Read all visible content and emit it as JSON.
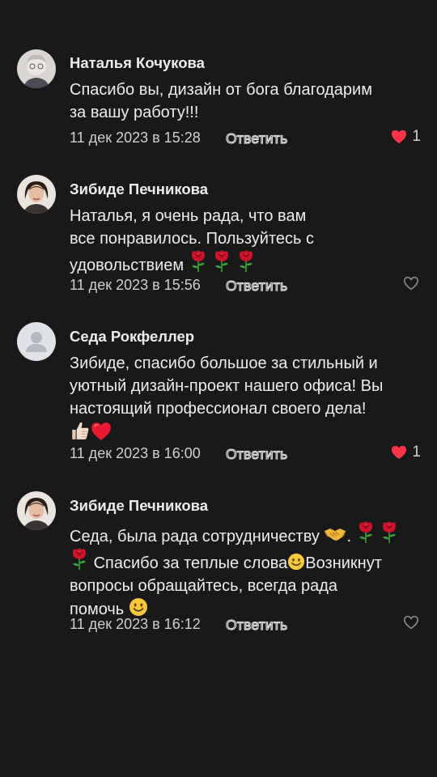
{
  "comments": [
    {
      "author": "Наталья Кочукова",
      "text_lines": [
        "Спасибо вы, дизайн от бога благодарим",
        "за вашу работу!!!"
      ],
      "date": "11 дек 2023 в 15:28",
      "reply_label": "Ответить",
      "liked": true,
      "like_count": "1"
    },
    {
      "author": "Зибиде Печникова",
      "text_lines": [
        "Наталья, я очень рада, что вам",
        "все понравилось. Пользуйтесь с",
        "удовольствием"
      ],
      "date": "11 дек 2023 в 15:56",
      "reply_label": "Ответить",
      "liked": false,
      "like_count": ""
    },
    {
      "author": "Седа Рокфеллер",
      "text_lines": [
        "Зибиде, спасибо большое за стильный и",
        "уютный дизайн-проект нашего офиса! Вы",
        "настоящий профессионал своего дела!"
      ],
      "date": "11 дек 2023 в 16:00",
      "reply_label": "Ответить",
      "liked": true,
      "like_count": "1"
    },
    {
      "author": "Зибиде Печникова",
      "text_lines": [
        "Седа, была рада сотрудничеству",
        "Спасибо за теплые слова",
        "Возникнут",
        "вопросы обращайтесь, всегда рада",
        "помочь"
      ],
      "date": "11 дек 2023 в 16:12",
      "reply_label": "Ответить",
      "liked": false,
      "like_count": ""
    }
  ],
  "icons": {
    "like_filled": "heart-filled-icon",
    "like_outline": "heart-outline-icon",
    "rose": "rose-emoji",
    "handshake": "handshake-emoji",
    "smile": "smile-emoji",
    "thumbs_up": "thumbs-up-emoji",
    "red_heart": "red-heart-emoji",
    "default_avatar": "user-placeholder-icon"
  },
  "colors": {
    "background": "#19191a",
    "like_active": "#ff3347",
    "like_inactive": "#8a8a8a"
  }
}
